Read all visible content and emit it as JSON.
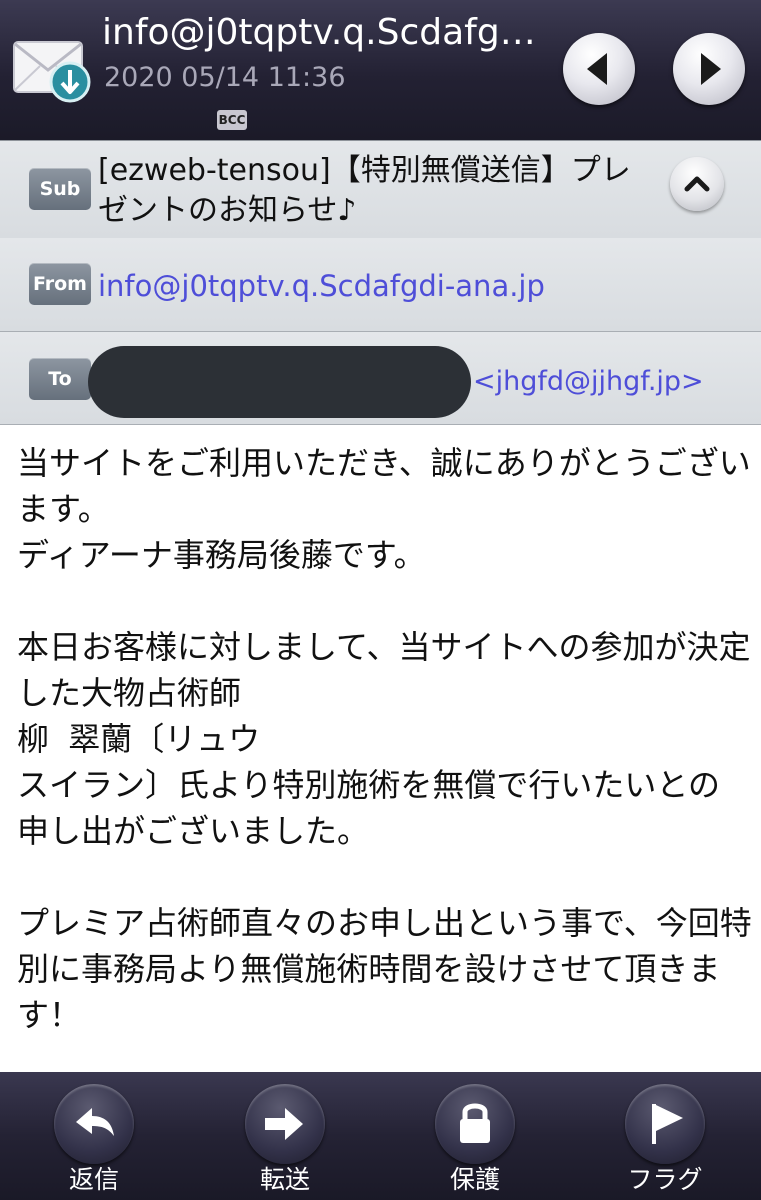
{
  "header": {
    "title": "info@j0tqptv.q.Scdafg…",
    "date": "2020 05/14 11:36",
    "bcc_badge": "BCC",
    "mail_icon": "mail-download-icon",
    "prev_icon": "chevron-left-icon",
    "next_icon": "chevron-right-icon"
  },
  "meta": {
    "subject_label": "Sub",
    "subject": "[ezweb-tensou]【特別無償送信】プレゼントのお知らせ♪",
    "from_label": "From",
    "from": "info@j0tqptv.q.Scdafgdi-ana.jp",
    "to_label": "To",
    "to": "<jhgfd@jjhgf.jp>"
  },
  "body": {
    "text": "当サイトをご利用いただき、誠にありがとうございます。\nディアーナ事務局後藤です。\n\n本日お客様に対しまして、当サイトへの参加が決定した大物占術師\n柳 翠蘭〔リュウ\nスイラン〕氏より特別施術を無償で行いたいとの申し出がございました。\n\nプレミア占術師直々のお申し出という事で、今回特別に事務局より無償施術時間を設けさせて頂きます！"
  },
  "toolbar": {
    "reply": "返信",
    "forward": "転送",
    "protect": "保護",
    "flag": "フラグ"
  },
  "colors": {
    "header_bg": "#232133",
    "meta_bg": "#dfe2e5",
    "link": "#4e4ed8",
    "chip": "#78818d"
  }
}
